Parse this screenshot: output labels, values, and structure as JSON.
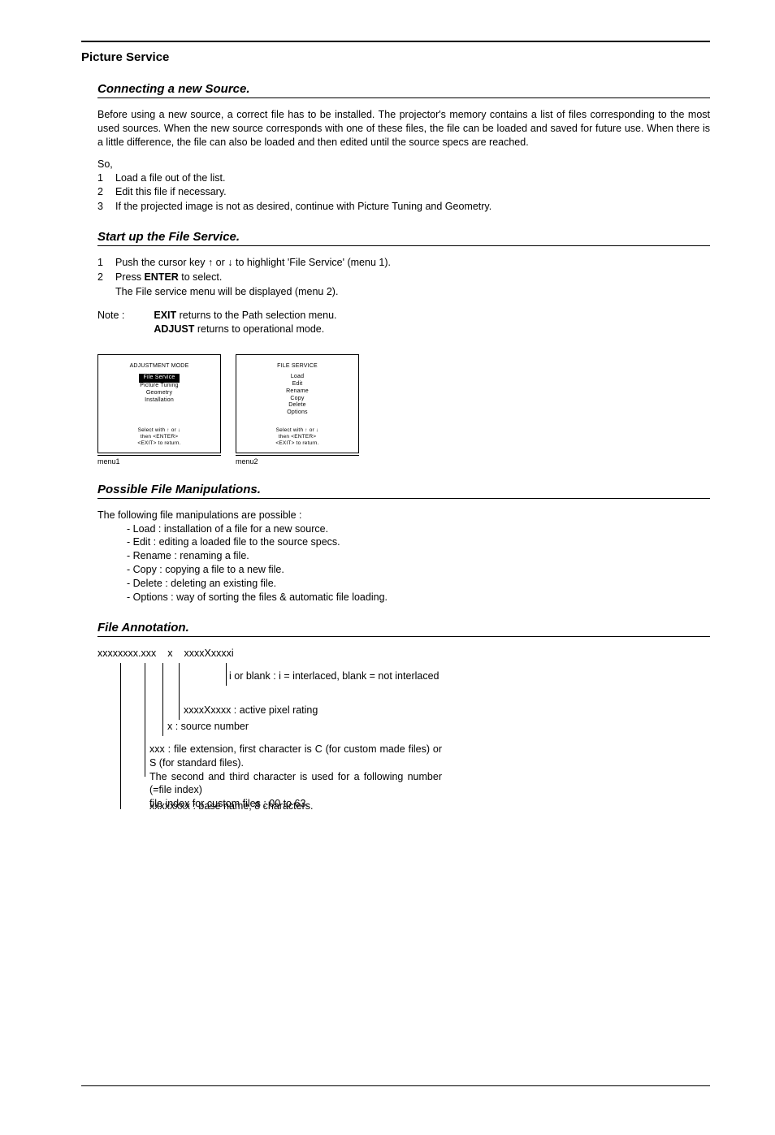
{
  "header": "Picture Service",
  "s1": {
    "title": "Connecting a new Source.",
    "intro": "Before using a new source, a correct file has to be installed.  The projector's memory contains a list of files corresponding to the most used sources.  When the new source corresponds with one of these files, the file can be loaded and saved for future use.  When there is a little difference, the file can also be loaded and then edited until the source specs are reached.",
    "so": "So,",
    "i1": "Load a file out of the list.",
    "i2": "Edit this file if necessary.",
    "i3": "If the projected image is not as desired, continue with Picture Tuning and Geometry."
  },
  "s2": {
    "title": "Start up the File Service.",
    "l1a": "Push the cursor key ",
    "l1b": " or ",
    "l1c": " to highlight 'File Service' (menu 1).",
    "l2a": "Press ",
    "l2b": "ENTER",
    "l2c": " to select.",
    "l3": "The File service menu will be displayed (menu 2).",
    "note_label": "Note :",
    "note1a": "EXIT",
    "note1b": " returns to the Path selection menu.",
    "note2a": "ADJUST",
    "note2b": " returns to operational mode."
  },
  "menu1": {
    "title": "ADJUSTMENT MODE",
    "items": [
      "File Service",
      "Picture Tuning",
      "Geometry",
      "Installation"
    ],
    "foot1": "Select with ↑ or ↓",
    "foot2": "then <ENTER>",
    "foot3": "<EXIT> to return.",
    "caption": "menu1"
  },
  "menu2": {
    "title": "FILE SERVICE",
    "items": [
      "Load",
      "Edit",
      "Rename",
      "Copy",
      "Delete",
      "Options"
    ],
    "foot1": "Select with ↑ or ↓",
    "foot2": "then <ENTER>",
    "foot3": "<EXIT> to return.",
    "caption": "menu2"
  },
  "s3": {
    "title": "Possible File Manipulations.",
    "intro": "The following file manipulations are possible :",
    "items": [
      "- Load : installation of a file for a new source.",
      "- Edit : editing a loaded file to the source specs.",
      "- Rename : renaming a file.",
      "- Copy : copying a file to a new file.",
      "- Delete :  deleting an existing file.",
      "- Options : way of sorting the files & automatic file loading."
    ]
  },
  "s4": {
    "title": "File Annotation.",
    "top_a": "xxxxxxxx.xxx",
    "top_b": "x",
    "top_c": "xxxxXxxxxi",
    "ann1": "i or blank : i = interlaced, blank = not interlaced",
    "ann2": "xxxxXxxxx : active pixel rating",
    "ann3": "x : source number",
    "ann4a": "xxx : file extension, first character is C (for custom made files) or S (for standard files).",
    "ann4b": "The second and third character is used for a following number (=file index)",
    "ann4c": "file index for custom files : 00 to 63.",
    "ann5": "xxxxxxxx : base name,  8 characters."
  }
}
